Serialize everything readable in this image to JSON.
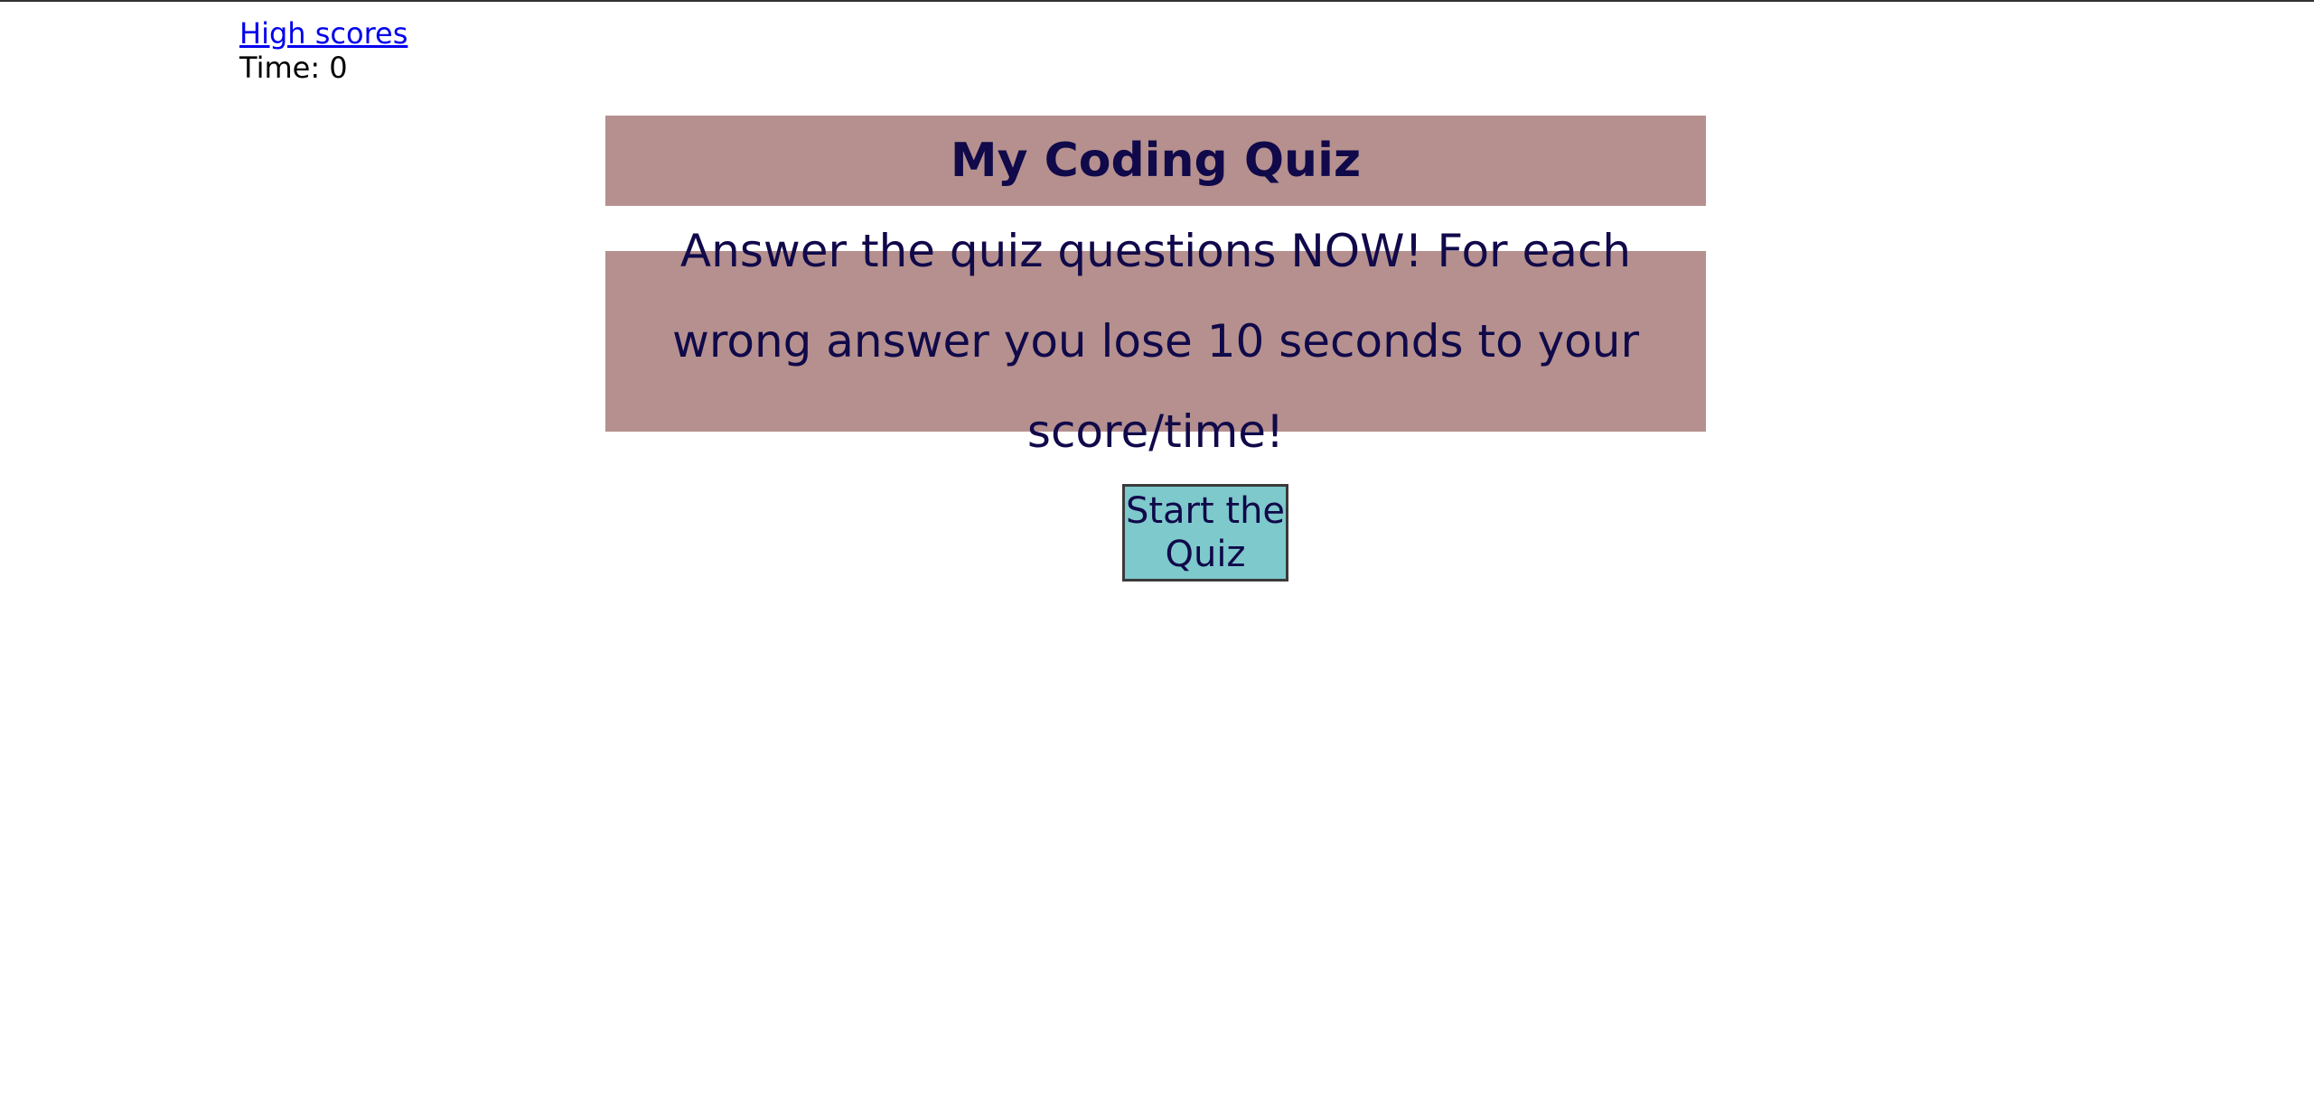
{
  "header": {
    "high_scores_link": "High scores",
    "time_label": "Time:",
    "time_value": "0"
  },
  "quiz": {
    "title": "My Coding Quiz",
    "instructions": "Answer the quiz questions NOW! For each wrong answer you lose 10 seconds to your score/time!",
    "start_button_label": "Start the Quiz"
  },
  "colors": {
    "panel_background": "#b5908e",
    "text_navy": "#10094a",
    "button_background": "#7dc9cb",
    "link": "#0000ee"
  }
}
